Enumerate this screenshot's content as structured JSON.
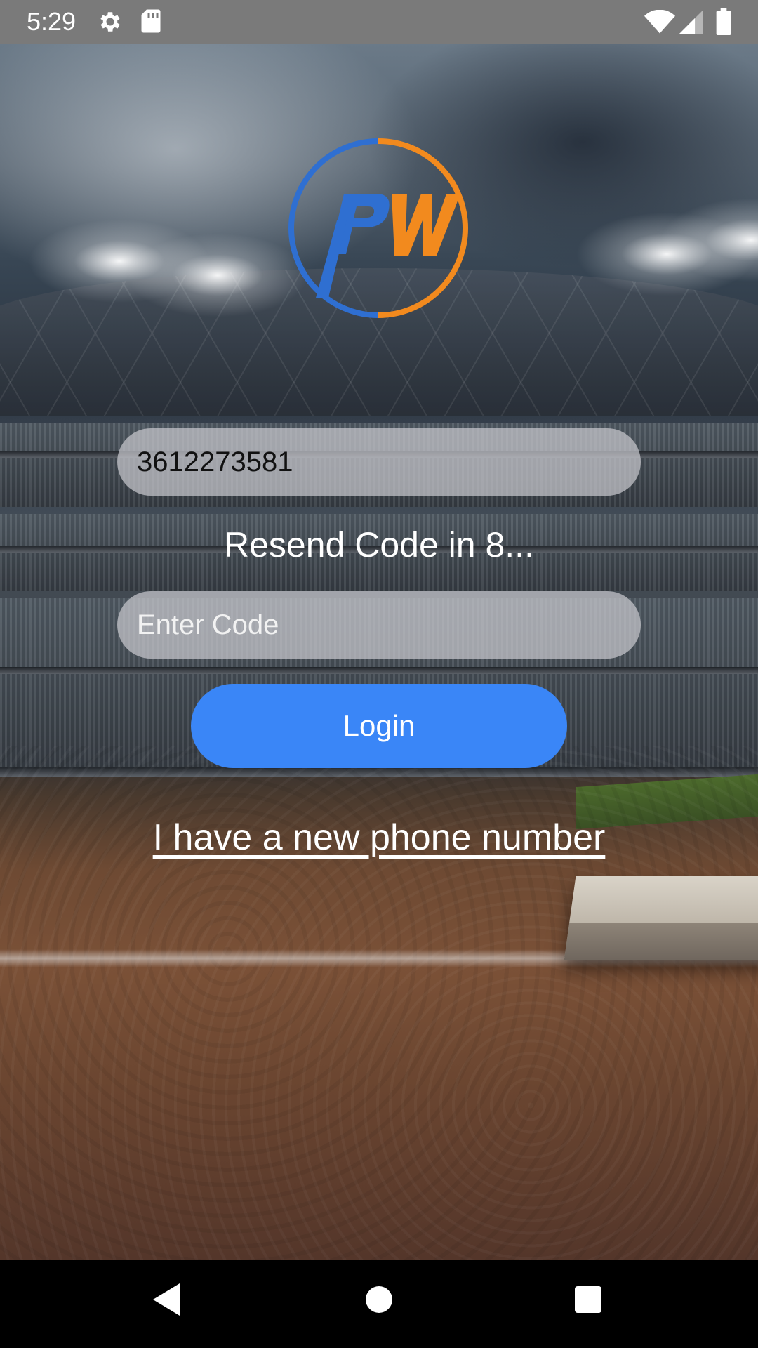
{
  "status_bar": {
    "time": "5:29",
    "left_icons": [
      "gear-icon",
      "sd-card-icon"
    ],
    "right_icons": [
      "wifi-icon",
      "cellular-signal-icon",
      "battery-icon"
    ]
  },
  "logo": {
    "text": "PW",
    "colors": {
      "blue": "#2f6fd1",
      "orange": "#f28a1e"
    }
  },
  "login_form": {
    "phone_field": {
      "value": "3612273581",
      "placeholder": ""
    },
    "resend_text": "Resend Code in 8...",
    "code_field": {
      "value": "",
      "placeholder": "Enter Code"
    },
    "login_label": "Login",
    "new_phone_link": "I have a new phone number"
  },
  "colors": {
    "accent": "#3a86f7",
    "field_bg": "rgba(200,200,205,0.72)",
    "status_bar_bg": "#7a7a7a",
    "nav_bar_bg": "#000000"
  },
  "nav_bar": {
    "buttons": [
      "back-icon",
      "home-icon",
      "recents-icon"
    ]
  }
}
